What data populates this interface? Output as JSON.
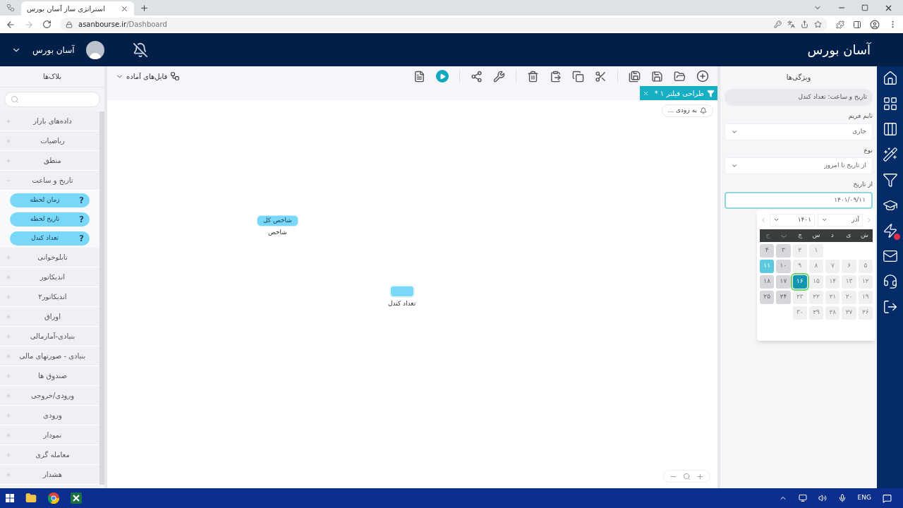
{
  "browser": {
    "tab_title": "استراتژی ساز آسان بورس",
    "url_host": "asanbourse.ir",
    "url_path": "/Dashboard"
  },
  "header": {
    "logo": "آسان بورس",
    "user_name": "آسان بورس"
  },
  "sidebar": {
    "title": "بلاک‌ها",
    "categories": [
      {
        "label": "داده‌های بازار",
        "expanded": false
      },
      {
        "label": "ریاضیات",
        "expanded": false
      },
      {
        "label": "منطق",
        "expanded": false
      },
      {
        "label": "تاریخ و ساعت",
        "expanded": true,
        "children": [
          {
            "label": "زمان لحظه",
            "help": "?"
          },
          {
            "label": "تاریخ لحظه",
            "help": "?"
          },
          {
            "label": "تعداد کندل",
            "help": "?"
          }
        ]
      },
      {
        "label": "تابلوخوانی",
        "expanded": false
      },
      {
        "label": "اندیکاتور",
        "expanded": false
      },
      {
        "label": "اندیکاتور۲",
        "expanded": false
      },
      {
        "label": "اوراق",
        "expanded": false
      },
      {
        "label": "بنیادی-آمارمالی",
        "expanded": false
      },
      {
        "label": "بنیادی - صورتهای مالی",
        "expanded": false
      },
      {
        "label": "صندوق ها",
        "expanded": false
      },
      {
        "label": "ورودی/خروجی",
        "expanded": false
      },
      {
        "label": "ورودی",
        "expanded": false
      },
      {
        "label": "نمودار",
        "expanded": false
      },
      {
        "label": "معامله گری",
        "expanded": false
      },
      {
        "label": "هشدار",
        "expanded": false
      }
    ]
  },
  "toolbar": {
    "templates": "فایل‌های آماده"
  },
  "canvas": {
    "tabs": [
      {
        "label": "طراحی فیلتر ۱ *",
        "selected": true
      }
    ],
    "notice": "به زودی ...",
    "blocks": [
      {
        "kind": "labeled",
        "label": "شاخص کل",
        "caption": "شاخص"
      },
      {
        "kind": "empty",
        "caption": "تعداد کندل"
      }
    ]
  },
  "properties": {
    "title": "ویژگی‌ها",
    "summary": "تاریخ و ساعت: تعداد کندل",
    "fields": [
      {
        "kind": "select",
        "label": "تایم فریم",
        "value": "جاری",
        "focused": false
      },
      {
        "kind": "select",
        "label": "نوع",
        "value": "از تاریخ تا امروز",
        "focused": false
      },
      {
        "kind": "date",
        "label": "از تاریخ",
        "value": "۱۴۰۱/۰۹/۱۱",
        "focused": true
      }
    ],
    "calendar": {
      "month": "آذر",
      "year": "۱۴۰۱",
      "weekdays": [
        "ش",
        "ی",
        "د",
        "س",
        "چ",
        "پ",
        "ج"
      ],
      "weeks": [
        [
          {
            "kind": "blank"
          },
          {
            "kind": "blank"
          },
          {
            "kind": "blank"
          },
          {
            "kind": "weekday",
            "day": "۱",
            "selected": false,
            "hovered": false
          },
          {
            "kind": "weekday",
            "day": "۲",
            "selected": false,
            "hovered": false
          },
          {
            "kind": "weekend",
            "day": "۳",
            "selected": false,
            "hovered": false
          },
          {
            "kind": "weekend",
            "day": "۴",
            "selected": false,
            "hovered": false
          }
        ],
        [
          {
            "kind": "weekday",
            "day": "۵",
            "selected": false,
            "hovered": false
          },
          {
            "kind": "weekday",
            "day": "۶",
            "selected": false,
            "hovered": false
          },
          {
            "kind": "weekday",
            "day": "۷",
            "selected": false,
            "hovered": false
          },
          {
            "kind": "weekday",
            "day": "۸",
            "selected": false,
            "hovered": false
          },
          {
            "kind": "weekday",
            "day": "۹",
            "selected": false,
            "hovered": false
          },
          {
            "kind": "weekend",
            "day": "۱۰",
            "selected": false,
            "hovered": false
          },
          {
            "kind": "weekend",
            "day": "۱۱",
            "selected": true,
            "hovered": false
          }
        ],
        [
          {
            "kind": "weekday",
            "day": "۱۲",
            "selected": false,
            "hovered": false
          },
          {
            "kind": "weekday",
            "day": "۱۳",
            "selected": false,
            "hovered": false
          },
          {
            "kind": "weekday",
            "day": "۱۴",
            "selected": false,
            "hovered": false
          },
          {
            "kind": "weekday",
            "day": "۱۵",
            "selected": false,
            "hovered": false
          },
          {
            "kind": "weekday",
            "day": "۱۶",
            "selected": false,
            "hovered": true
          },
          {
            "kind": "weekend",
            "day": "۱۷",
            "selected": false,
            "hovered": false
          },
          {
            "kind": "weekend",
            "day": "۱۸",
            "selected": false,
            "hovered": false
          }
        ],
        [
          {
            "kind": "weekday",
            "day": "۱۹",
            "selected": false,
            "hovered": false
          },
          {
            "kind": "weekday",
            "day": "۲۰",
            "selected": false,
            "hovered": false
          },
          {
            "kind": "weekday",
            "day": "۲۱",
            "selected": false,
            "hovered": false
          },
          {
            "kind": "weekday",
            "day": "۲۲",
            "selected": false,
            "hovered": false
          },
          {
            "kind": "weekday",
            "day": "۲۳",
            "selected": false,
            "hovered": false
          },
          {
            "kind": "weekend",
            "day": "۲۴",
            "selected": false,
            "hovered": false
          },
          {
            "kind": "weekend",
            "day": "۲۵",
            "selected": false,
            "hovered": false
          }
        ],
        [
          {
            "kind": "weekday",
            "day": "۲۶",
            "selected": false,
            "hovered": false
          },
          {
            "kind": "weekday",
            "day": "۲۷",
            "selected": false,
            "hovered": false
          },
          {
            "kind": "weekday",
            "day": "۲۸",
            "selected": false,
            "hovered": false
          },
          {
            "kind": "weekday",
            "day": "۲۹",
            "selected": false,
            "hovered": false
          },
          {
            "kind": "weekday",
            "day": "۳۰",
            "selected": false,
            "hovered": false
          },
          {
            "kind": "blank"
          },
          {
            "kind": "blank"
          }
        ]
      ]
    }
  },
  "taskbar": {
    "language": "ENG"
  }
}
